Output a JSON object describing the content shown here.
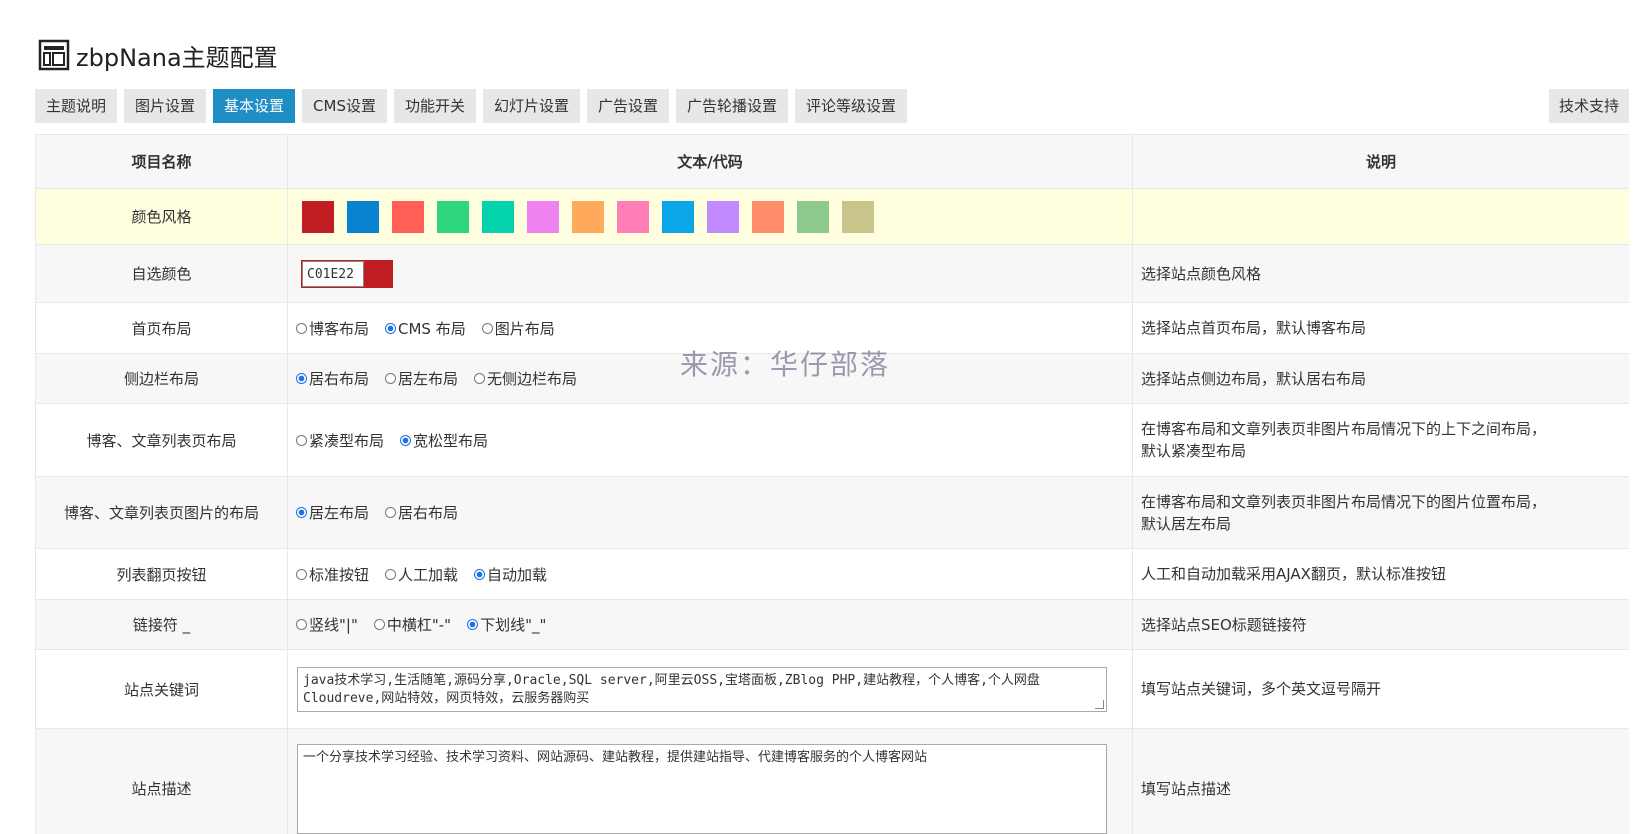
{
  "header": {
    "title": "zbpNana主题配置"
  },
  "tabs": [
    {
      "label": "主题说明"
    },
    {
      "label": "图片设置"
    },
    {
      "label": "基本设置"
    },
    {
      "label": "CMS设置"
    },
    {
      "label": "功能开关"
    },
    {
      "label": "幻灯片设置"
    },
    {
      "label": "广告设置"
    },
    {
      "label": "广告轮播设置"
    },
    {
      "label": "评论等级设置"
    }
  ],
  "active_tab": "基本设置",
  "support_label": "技术支持",
  "table": {
    "headers": {
      "name": "项目名称",
      "text": "文本/代码",
      "desc": "说明"
    },
    "color_style": {
      "name": "颜色风格",
      "swatches": [
        "#c01e22",
        "#0883cf",
        "#ff5f55",
        "#2ed67e",
        "#05d3ac",
        "#ee82ee",
        "#ffa95c",
        "#ff7eb8",
        "#0aa6e8",
        "#c28aff",
        "#ff8c6a",
        "#8ec98e",
        "#c8c48a"
      ]
    },
    "custom_color": {
      "name": "自选颜色",
      "value": "C01E22",
      "desc": "选择站点颜色风格"
    },
    "home_layout": {
      "name": "首页布局",
      "options": [
        {
          "label": "博客布局",
          "checked": false
        },
        {
          "label": "CMS 布局",
          "checked": true
        },
        {
          "label": "图片布局",
          "checked": false
        }
      ],
      "desc": "选择站点首页布局，默认博客布局"
    },
    "sidebar_layout": {
      "name": "侧边栏布局",
      "options": [
        {
          "label": "居右布局",
          "checked": true
        },
        {
          "label": "居左布局",
          "checked": false
        },
        {
          "label": "无侧边栏布局",
          "checked": false
        }
      ],
      "desc": "选择站点侧边布局，默认居右布局"
    },
    "list_layout": {
      "name": "博客、文章列表页布局",
      "options": [
        {
          "label": "紧凑型布局",
          "checked": false
        },
        {
          "label": "宽松型布局",
          "checked": true
        }
      ],
      "desc_line1": "在博客布局和文章列表页非图片布局情况下的上下之间布局，",
      "desc_line2": "默认紧凑型布局"
    },
    "list_image_layout": {
      "name": "博客、文章列表页图片的布局",
      "options": [
        {
          "label": "居左布局",
          "checked": true
        },
        {
          "label": "居右布局",
          "checked": false
        }
      ],
      "desc_line1": "在博客布局和文章列表页非图片布局情况下的图片位置布局，",
      "desc_line2": "默认居左布局"
    },
    "pager": {
      "name": "列表翻页按钮",
      "options": [
        {
          "label": "标准按钮",
          "checked": false
        },
        {
          "label": "人工加载",
          "checked": false
        },
        {
          "label": "自动加载",
          "checked": true
        }
      ],
      "desc": "人工和自动加载采用AJAX翻页，默认标准按钮"
    },
    "separator": {
      "name": "链接符 _",
      "options": [
        {
          "label": "竖线\"|\"",
          "checked": false
        },
        {
          "label": "中横杠\"-\"",
          "checked": false
        },
        {
          "label": "下划线\"_\"",
          "checked": true
        }
      ],
      "desc": "选择站点SEO标题链接符"
    },
    "keywords": {
      "name": "站点关键词",
      "line1": "java技术学习,生活随笔,源码分享,Oracle,SQL server,阿里云OSS,宝塔面板,ZBlog PHP,建站教程，个人博客,个人网盘",
      "line2": "Cloudreve,网站特效，网页特效，云服务器购买",
      "desc": "填写站点关键词，多个英文逗号隔开"
    },
    "description": {
      "name": "站点描述",
      "value": "一个分享技术学习经验、技术学习资料、网站源码、建站教程，提供建站指导、代建博客服务的个人博客网站",
      "desc": "填写站点描述"
    }
  },
  "watermark": "来源：华仔部落",
  "colors": {
    "accent": "#1e8ec4",
    "highlight_row": "#ffffe0"
  }
}
